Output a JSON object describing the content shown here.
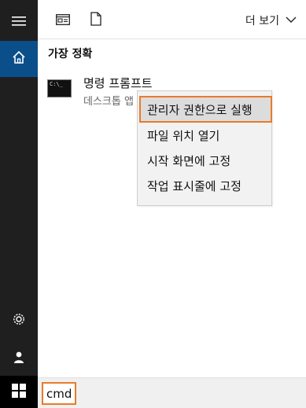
{
  "topbar": {
    "more_label": "더 보기"
  },
  "section": {
    "title": "가장 정확"
  },
  "best_match": {
    "title": "명령 프롬프트",
    "subtitle": "데스크톱 앱",
    "icon_prompt": "C:\\_"
  },
  "context_menu": {
    "items": [
      "관리자 권한으로 실행",
      "파일 위치 열기",
      "시작 화면에 고정",
      "작업 표시줄에 고정"
    ]
  },
  "search": {
    "value": "cmd"
  },
  "colors": {
    "rail_bg": "#1f1f1f",
    "home_highlight": "#0b4f8a",
    "accent_outline": "#ea7a2a"
  },
  "icons": {
    "menu": "hamburger-icon",
    "home": "home-icon",
    "settings": "gear-icon",
    "user": "user-icon",
    "start": "windows-logo-icon",
    "apps": "apps-icon",
    "document": "document-icon",
    "more": "chevron-down-icon"
  }
}
